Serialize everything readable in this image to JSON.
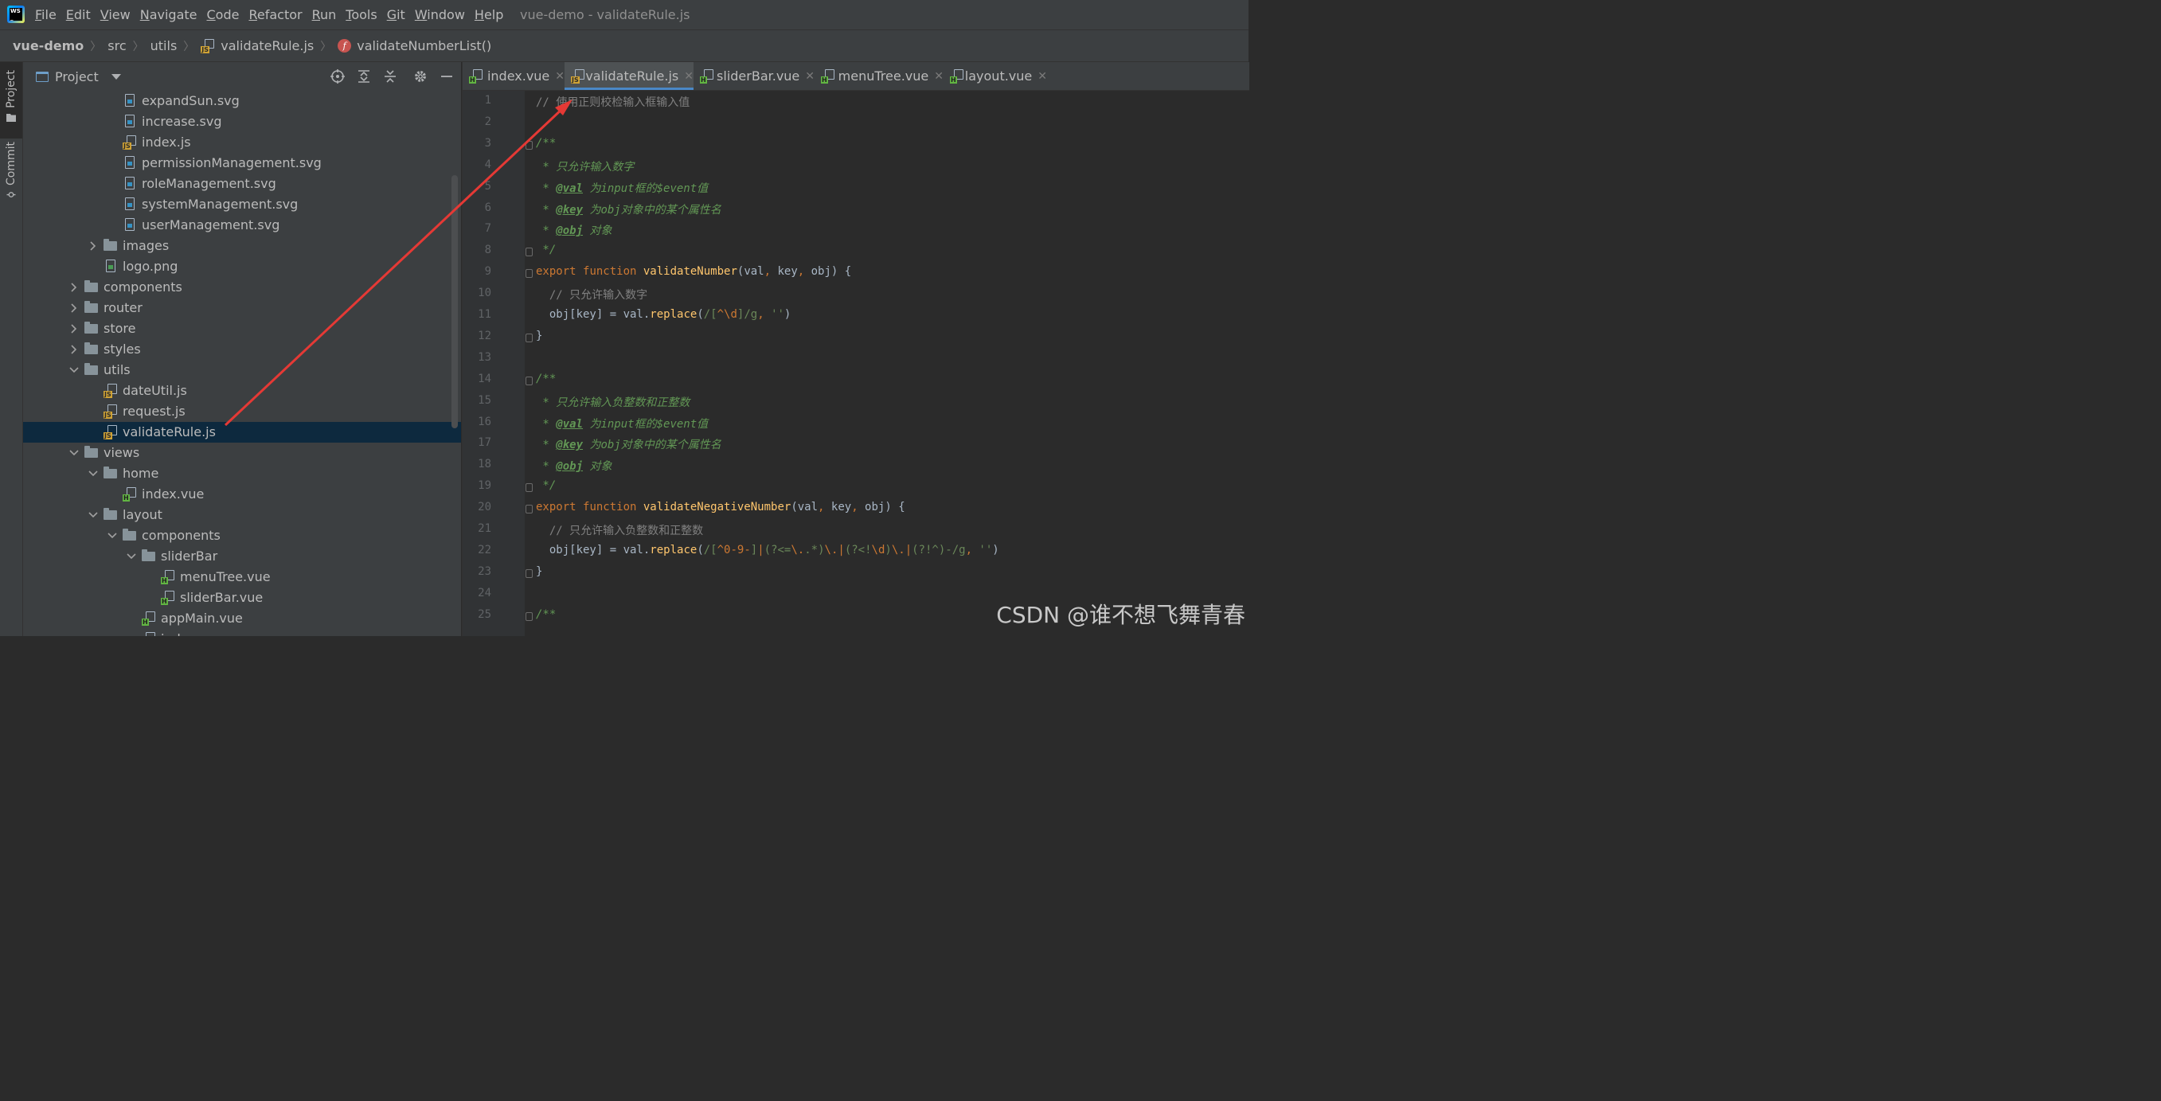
{
  "menubar": {
    "items": [
      {
        "u": "F",
        "rest": "ile"
      },
      {
        "u": "E",
        "rest": "dit"
      },
      {
        "u": "V",
        "rest": "iew"
      },
      {
        "u": "N",
        "rest": "avigate"
      },
      {
        "u": "C",
        "rest": "ode"
      },
      {
        "u": "R",
        "rest": "efactor"
      },
      {
        "u": "R",
        "rest": "un"
      },
      {
        "u": "T",
        "rest": "ools"
      },
      {
        "u": "G",
        "rest": "it"
      },
      {
        "u": "W",
        "rest": "indow"
      },
      {
        "u": "H",
        "rest": "elp"
      }
    ],
    "window_title": "vue-demo - validateRule.js"
  },
  "breadcrumbs": {
    "project": "vue-demo",
    "src": "src",
    "utils": "utils",
    "file": "validateRule.js",
    "function": "validateNumberList()"
  },
  "toolstrip": {
    "project": "Project",
    "commit": "Commit"
  },
  "project_panel": {
    "title": "Project",
    "tree": [
      {
        "label": "expandSun.svg",
        "type": "svg",
        "depth": 5
      },
      {
        "label": "increase.svg",
        "type": "svg",
        "depth": 5
      },
      {
        "label": "index.js",
        "type": "js",
        "depth": 5
      },
      {
        "label": "permissionManagement.svg",
        "type": "svg",
        "depth": 5
      },
      {
        "label": "roleManagement.svg",
        "type": "svg",
        "depth": 5
      },
      {
        "label": "systemManagement.svg",
        "type": "svg",
        "depth": 5
      },
      {
        "label": "userManagement.svg",
        "type": "svg",
        "depth": 5
      },
      {
        "label": "images",
        "type": "folder",
        "depth": 4,
        "state": "collapsed"
      },
      {
        "label": "logo.png",
        "type": "png",
        "depth": 4
      },
      {
        "label": "components",
        "type": "folder",
        "depth": 3,
        "state": "collapsed"
      },
      {
        "label": "router",
        "type": "folder",
        "depth": 3,
        "state": "collapsed"
      },
      {
        "label": "store",
        "type": "folder",
        "depth": 3,
        "state": "collapsed"
      },
      {
        "label": "styles",
        "type": "folder",
        "depth": 3,
        "state": "collapsed"
      },
      {
        "label": "utils",
        "type": "folder",
        "depth": 3,
        "state": "expanded"
      },
      {
        "label": "dateUtil.js",
        "type": "js",
        "depth": 4
      },
      {
        "label": "request.js",
        "type": "js",
        "depth": 4
      },
      {
        "label": "validateRule.js",
        "type": "js",
        "depth": 4,
        "selected": true
      },
      {
        "label": "views",
        "type": "folder",
        "depth": 3,
        "state": "expanded"
      },
      {
        "label": "home",
        "type": "folder",
        "depth": 4,
        "state": "expanded"
      },
      {
        "label": "index.vue",
        "type": "vue",
        "depth": 5
      },
      {
        "label": "layout",
        "type": "folder",
        "depth": 4,
        "state": "expanded"
      },
      {
        "label": "components",
        "type": "folder",
        "depth": 5,
        "state": "expanded"
      },
      {
        "label": "sliderBar",
        "type": "folder",
        "depth": 6,
        "state": "expanded"
      },
      {
        "label": "menuTree.vue",
        "type": "vue",
        "depth": 7
      },
      {
        "label": "sliderBar.vue",
        "type": "vue",
        "depth": 7
      },
      {
        "label": "appMain.vue",
        "type": "vue",
        "depth": 6
      },
      {
        "label": "index.vue",
        "type": "vue",
        "depth": 6
      }
    ]
  },
  "tabs": [
    {
      "label": "index.vue",
      "type": "vue"
    },
    {
      "label": "validateRule.js",
      "type": "js",
      "active": true
    },
    {
      "label": "sliderBar.vue",
      "type": "vue"
    },
    {
      "label": "menuTree.vue",
      "type": "vue"
    },
    {
      "label": "layout.vue",
      "type": "vue"
    }
  ],
  "editor": {
    "lines": [
      [
        [
          "c-comment",
          "// 使用正则校检输入框输入值"
        ]
      ],
      [],
      [
        [
          "c-doc",
          "/**"
        ]
      ],
      [
        [
          "c-doc",
          " * 只允许输入数字"
        ]
      ],
      [
        [
          "c-doc",
          " * "
        ],
        [
          "c-tag",
          "@val"
        ],
        [
          "c-doc",
          " 为input框的$event值"
        ]
      ],
      [
        [
          "c-doc",
          " * "
        ],
        [
          "c-tag",
          "@key"
        ],
        [
          "c-doc",
          " 为obj对象中的某个属性名"
        ]
      ],
      [
        [
          "c-doc",
          " * "
        ],
        [
          "c-tag",
          "@obj"
        ],
        [
          "c-doc",
          " 对象"
        ]
      ],
      [
        [
          "c-doc",
          " */"
        ]
      ],
      [
        [
          "c-kw",
          "export "
        ],
        [
          "c-kw",
          "function "
        ],
        [
          "c-fn",
          "validateNumber"
        ],
        [
          "",
          "(val"
        ],
        [
          "c-punc",
          ", "
        ],
        [
          "",
          "key"
        ],
        [
          "c-punc",
          ", "
        ],
        [
          "",
          "obj) {"
        ]
      ],
      [
        [
          "",
          "  "
        ],
        [
          "c-comment",
          "// 只允许输入数字"
        ]
      ],
      [
        [
          "",
          "  obj[key] = val."
        ],
        [
          "c-fn",
          "replace"
        ],
        [
          "",
          "("
        ],
        [
          "c-re",
          "/["
        ],
        [
          "c-re-b",
          "^\\d"
        ],
        [
          "c-re",
          "]/g"
        ],
        [
          "c-punc",
          ", "
        ],
        [
          "c-str",
          "''"
        ],
        [
          "",
          ")"
        ]
      ],
      [
        [
          "",
          "}"
        ]
      ],
      [],
      [
        [
          "c-doc",
          "/**"
        ]
      ],
      [
        [
          "c-doc",
          " * 只允许输入负整数和正整数"
        ]
      ],
      [
        [
          "c-doc",
          " * "
        ],
        [
          "c-tag",
          "@val"
        ],
        [
          "c-doc",
          " 为input框的$event值"
        ]
      ],
      [
        [
          "c-doc",
          " * "
        ],
        [
          "c-tag",
          "@key"
        ],
        [
          "c-doc",
          " 为obj对象中的某个属性名"
        ]
      ],
      [
        [
          "c-doc",
          " * "
        ],
        [
          "c-tag",
          "@obj"
        ],
        [
          "c-doc",
          " 对象"
        ]
      ],
      [
        [
          "c-doc",
          " */"
        ]
      ],
      [
        [
          "c-kw",
          "export "
        ],
        [
          "c-kw",
          "function "
        ],
        [
          "c-fn",
          "validateNegativeNumber"
        ],
        [
          "",
          "(val"
        ],
        [
          "c-punc",
          ", "
        ],
        [
          "",
          "key"
        ],
        [
          "c-punc",
          ", "
        ],
        [
          "",
          "obj) {"
        ]
      ],
      [
        [
          "",
          "  "
        ],
        [
          "c-comment",
          "// 只允许输入负整数和正整数"
        ]
      ],
      [
        [
          "",
          "  obj[key] = val."
        ],
        [
          "c-fn",
          "replace"
        ],
        [
          "",
          "("
        ],
        [
          "c-re",
          "/["
        ],
        [
          "c-re-b",
          "^0-9-"
        ],
        [
          "c-re",
          "]"
        ],
        [
          "c-re-b",
          "|"
        ],
        [
          "c-re",
          "(?<="
        ],
        [
          "c-re-b",
          "\\."
        ],
        [
          "c-re",
          ".*)"
        ],
        [
          "c-re-b",
          "\\."
        ],
        [
          "c-re-b",
          "|"
        ],
        [
          "c-re",
          "(?<!"
        ],
        [
          "c-re-b",
          "\\d"
        ],
        [
          "c-re",
          ")"
        ],
        [
          "c-re-b",
          "\\."
        ],
        [
          "c-re-b",
          "|"
        ],
        [
          "c-re",
          "(?!^)-/g"
        ],
        [
          "c-punc",
          ", "
        ],
        [
          "c-str",
          "''"
        ],
        [
          "",
          ")"
        ]
      ],
      [
        [
          "",
          "}"
        ]
      ],
      [],
      [
        [
          "c-doc",
          "/**"
        ]
      ]
    ]
  },
  "watermark": "CSDN @谁不想飞舞青春",
  "colors": {
    "annotation_arrow": "#e53935",
    "selection": "#0d293e",
    "active_tab_underline": "#4a88c7"
  }
}
